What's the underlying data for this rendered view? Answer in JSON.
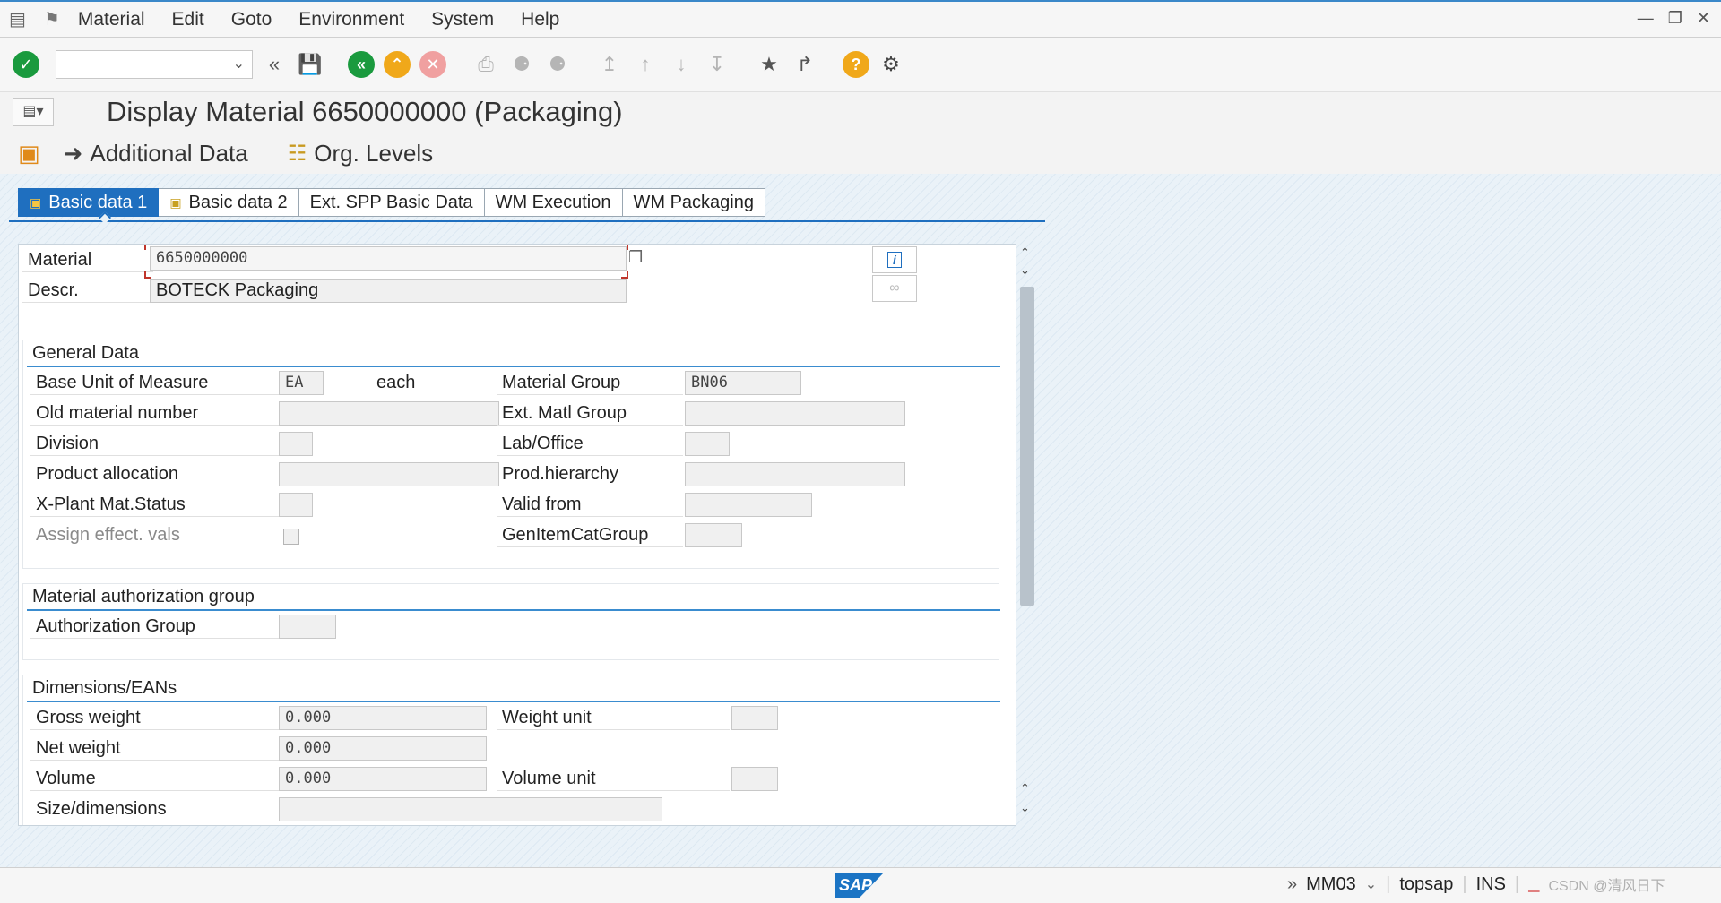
{
  "menu": {
    "items": [
      "Material",
      "Edit",
      "Goto",
      "Environment",
      "System",
      "Help"
    ]
  },
  "toolbar": {
    "command_value": ""
  },
  "title": "Display Material 6650000000 (Packaging)",
  "app_toolbar": {
    "additional_data": "Additional Data",
    "org_levels": "Org. Levels"
  },
  "tabs": [
    "Basic data 1",
    "Basic data 2",
    "Ext. SPP Basic Data",
    "WM Execution",
    "WM Packaging"
  ],
  "header": {
    "material_label": "Material",
    "material_value": "6650000000",
    "descr_label": "Descr.",
    "descr_value": "BOTECK Packaging"
  },
  "general_data": {
    "title": "General Data",
    "base_uom_label": "Base Unit of Measure",
    "base_uom_value": "EA",
    "base_uom_text": "each",
    "material_group_label": "Material Group",
    "material_group_value": "BN06",
    "old_material_label": "Old material number",
    "ext_matl_group_label": "Ext. Matl Group",
    "division_label": "Division",
    "lab_office_label": "Lab/Office",
    "product_allocation_label": "Product allocation",
    "prod_hierarchy_label": "Prod.hierarchy",
    "xplant_status_label": "X-Plant Mat.Status",
    "valid_from_label": "Valid from",
    "assign_effect_label": "Assign effect. vals",
    "gen_item_cat_label": "GenItemCatGroup"
  },
  "auth_group": {
    "title": "Material authorization group",
    "label": "Authorization Group"
  },
  "dimensions": {
    "title": "Dimensions/EANs",
    "gross_weight_label": "Gross weight",
    "gross_weight_value": "0.000",
    "weight_unit_label": "Weight unit",
    "net_weight_label": "Net weight",
    "net_weight_value": "0.000",
    "volume_label": "Volume",
    "volume_value": "0.000",
    "volume_unit_label": "Volume unit",
    "size_label": "Size/dimensions"
  },
  "status": {
    "sap": "SAP",
    "transaction": "MM03",
    "server": "topsap",
    "mode": "INS",
    "watermark": "CSDN @清风日下"
  },
  "colors": {
    "accent": "#1f6fbf",
    "ok_green": "#1a9a3e",
    "nav_orange": "#f0a81a",
    "cancel_red": "#e05555"
  }
}
